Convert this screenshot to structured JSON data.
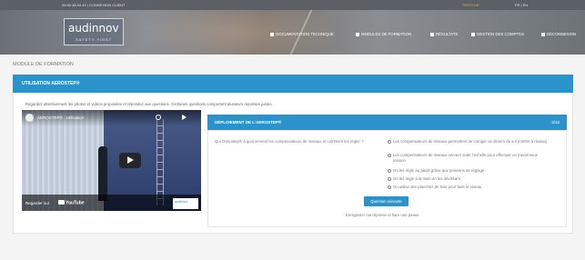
{
  "topbar": {
    "phone": "09 86 38 94 42 | CONNEXION CLIENT",
    "user": "TESTEUR",
    "lang": "FR | EN"
  },
  "logo": {
    "name": "audinnov",
    "tagline": "SAFETY FIRST"
  },
  "nav": [
    {
      "label": "DOCUMENTATION TECHNIQUE",
      "icon": "document-icon"
    },
    {
      "label": "MODULES DE FORMATION",
      "icon": "question-icon"
    },
    {
      "label": "RÉSULTATS",
      "icon": "chart-icon"
    },
    {
      "label": "GESTION DES COMPTES",
      "icon": "accounts-icon"
    },
    {
      "label": "DÉCONNEXION",
      "icon": "logout-icon"
    }
  ],
  "page": {
    "title": "MODULE DE FORMATION"
  },
  "section": {
    "title": "UTILISATION AEROSTEP®",
    "instructions": "Regardez attentivement les photos et vidéos proposées et répondez aux questions. Certaines questions comportent plusieurs réponses justes."
  },
  "video": {
    "title": "AEROSTEP® - Utilisation",
    "watch_label": "Regarder sur",
    "youtube_label": "YouTube",
    "corner_label": "audinnov"
  },
  "quiz": {
    "title": "DÉPLOIEMENT DE L'AEROSTEP®",
    "progress": "3/10",
    "question": "Qui l'Aérostep® à quoi servent les compensateurs de niveaux et comment les régler ?",
    "options": [
      "Les compensateurs de niveaux permettent de corriger un dévers du sol (mettre à niveau)",
      "Les compensateurs de niveaux servent outer l'échelle pour effectuer un travail sous tension",
      "On les règle au pieds grâce aux poissons de réglage",
      "On les règle à la main en les dévissant",
      "On utilise des planches de bois pour faire le niveau"
    ],
    "next_label": "Question suivante",
    "save_label": "Enregistrer ma réponse et faire une pause"
  }
}
